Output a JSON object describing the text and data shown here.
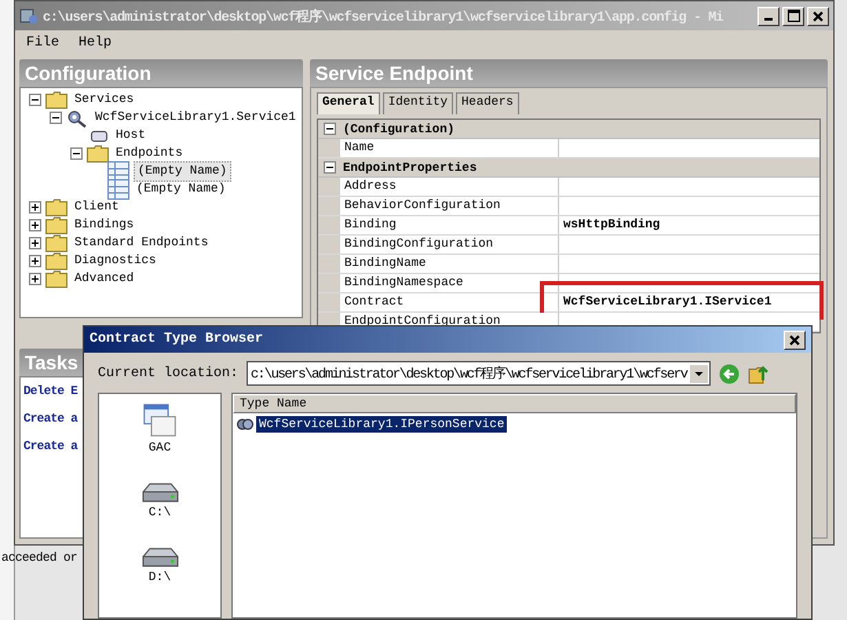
{
  "background": {
    "status_text": "acceeded or"
  },
  "window": {
    "title": "c:\\users\\administrator\\desktop\\wcf程序\\wcfservicelibrary1\\wcfservicelibrary1\\app.config - Mi",
    "active": false
  },
  "menu": [
    "File",
    "Help"
  ],
  "configuration": {
    "title": "Configuration",
    "tree": [
      {
        "label": "Services",
        "kind": "folder",
        "expanded": true,
        "selected": false,
        "children": [
          {
            "label": "WcfServiceLibrary1.Service1",
            "kind": "service",
            "expanded": true,
            "selected": false,
            "children": [
              {
                "label": "Host",
                "kind": "host",
                "selected": false
              },
              {
                "label": "Endpoints",
                "kind": "folder",
                "expanded": true,
                "selected": false,
                "children": [
                  {
                    "label": "(Empty Name)",
                    "kind": "endpoint",
                    "selected": true
                  },
                  {
                    "label": "(Empty Name)",
                    "kind": "endpoint",
                    "selected": false
                  }
                ]
              }
            ]
          }
        ]
      },
      {
        "label": "Client",
        "kind": "folder",
        "expanded": false,
        "selected": false
      },
      {
        "label": "Bindings",
        "kind": "folder",
        "expanded": false,
        "selected": false
      },
      {
        "label": "Standard Endpoints",
        "kind": "folder",
        "expanded": false,
        "selected": false
      },
      {
        "label": "Diagnostics",
        "kind": "folder",
        "expanded": false,
        "selected": false
      },
      {
        "label": "Advanced",
        "kind": "folder",
        "expanded": false,
        "selected": false
      }
    ]
  },
  "tasks": {
    "title": "Tasks",
    "items": [
      "Delete E",
      "Create a",
      "Create a"
    ]
  },
  "service_endpoint": {
    "title": "Service Endpoint",
    "tabs": [
      {
        "label": "General",
        "selected": true
      },
      {
        "label": "Identity",
        "selected": false
      },
      {
        "label": "Headers",
        "selected": false
      }
    ],
    "grid": [
      {
        "category": "(Configuration)",
        "expanded": true,
        "rows": [
          {
            "name": "Name",
            "highlighted": false
          }
        ]
      },
      {
        "category": "EndpointProperties",
        "expanded": true,
        "rows": [
          {
            "name": "Address",
            "highlighted": false
          },
          {
            "name": "BehaviorConfiguration",
            "highlighted": false
          },
          {
            "name": "Binding",
            "value": "wsHttpBinding",
            "highlighted": false
          },
          {
            "name": "BindingConfiguration",
            "highlighted": false
          },
          {
            "name": "BindingName",
            "highlighted": false
          },
          {
            "name": "BindingNamespace",
            "highlighted": false
          },
          {
            "name": "Contract",
            "value": "WcfServiceLibrary1.IService1",
            "highlighted": true
          },
          {
            "name": "EndpointConfiguration",
            "highlighted": false
          }
        ]
      }
    ]
  },
  "dialog": {
    "title": "Contract Type Browser",
    "location_label": "Current location:",
    "location_value": "c:\\users\\administrator\\desktop\\wcf程序\\wcfservicelibrary1\\wcfserv",
    "places": [
      {
        "label": "GAC",
        "kind": "gac"
      },
      {
        "label": "C:\\",
        "kind": "drive"
      },
      {
        "label": "D:\\",
        "kind": "drive"
      }
    ],
    "column": "Type Name",
    "types": [
      {
        "name": "WcfServiceLibrary1.IPersonService",
        "selected": true
      }
    ]
  }
}
